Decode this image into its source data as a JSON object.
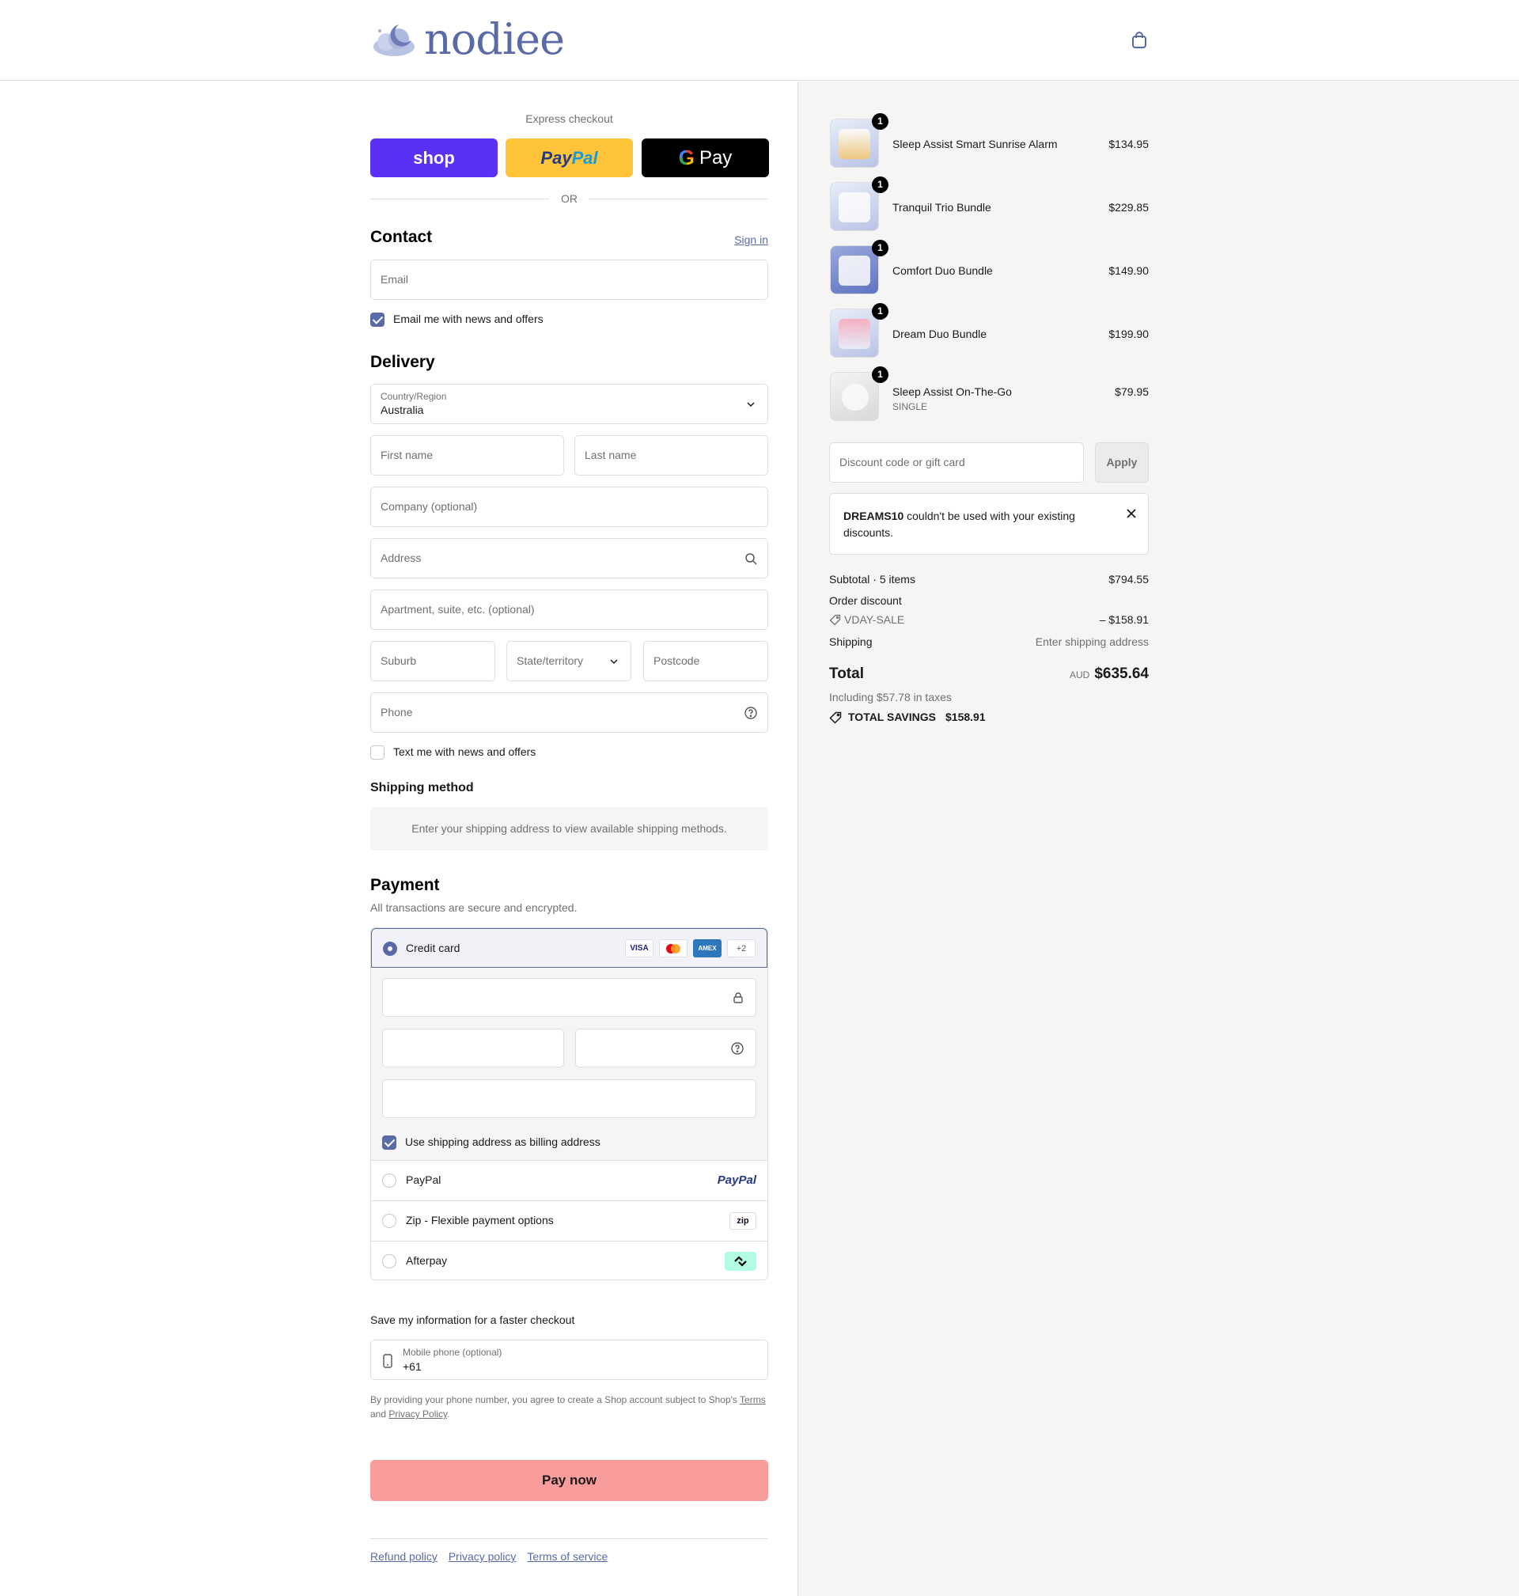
{
  "brand": {
    "name": "nodiee"
  },
  "express": {
    "title": "Express checkout",
    "shop_label": "shop",
    "paypal_a": "Pay",
    "paypal_b": "Pal",
    "gpay_g": "G",
    "gpay_label": "Pay",
    "or_label": "OR"
  },
  "contact": {
    "heading": "Contact",
    "sign_in": "Sign in",
    "email_placeholder": "Email",
    "news_label": "Email me with news and offers",
    "news_checked": true
  },
  "delivery": {
    "heading": "Delivery",
    "country_label": "Country/Region",
    "country_value": "Australia",
    "first_name": "First name",
    "last_name": "Last name",
    "company": "Company (optional)",
    "address": "Address",
    "apartment": "Apartment, suite, etc. (optional)",
    "suburb": "Suburb",
    "state": "State/territory",
    "postcode": "Postcode",
    "phone": "Phone",
    "text_label": "Text me with news and offers"
  },
  "shipping_method": {
    "heading": "Shipping method",
    "note": "Enter your shipping address to view available shipping methods."
  },
  "payment": {
    "heading": "Payment",
    "subtitle": "All transactions are secure and encrypted.",
    "credit_card": "Credit card",
    "card_logos": [
      "VISA",
      "AMEX",
      "+2"
    ],
    "billing_label": "Use shipping address as billing address",
    "options": [
      {
        "label": "PayPal",
        "logo": "PayPal"
      },
      {
        "label": "Zip - Flexible payment options",
        "logo": "zip"
      },
      {
        "label": "Afterpay",
        "logo": "afterpay-icon"
      }
    ]
  },
  "save_info": {
    "heading": "Save my information for a faster checkout",
    "mobile_label": "Mobile phone (optional)",
    "mobile_value": "+61",
    "legal_1": "By providing your phone number, you agree to create a Shop account subject to Shop's",
    "terms": "Terms",
    "and": "and",
    "privacy": "Privacy Policy",
    "period": "."
  },
  "pay_now": "Pay now",
  "footer": {
    "refund": "Refund policy",
    "privacy": "Privacy policy",
    "terms": "Terms of service"
  },
  "order": {
    "items": [
      {
        "name": "Sleep Assist Smart Sunrise Alarm",
        "price": "$134.95",
        "qty": "1",
        "variant": ""
      },
      {
        "name": "Tranquil Trio Bundle",
        "price": "$229.85",
        "qty": "1",
        "variant": ""
      },
      {
        "name": "Comfort Duo Bundle",
        "price": "$149.90",
        "qty": "1",
        "variant": ""
      },
      {
        "name": "Dream Duo Bundle",
        "price": "$199.90",
        "qty": "1",
        "variant": ""
      },
      {
        "name": "Sleep Assist On-The-Go",
        "price": "$79.95",
        "qty": "1",
        "variant": "SINGLE"
      }
    ],
    "discount_placeholder": "Discount code or gift card",
    "apply_label": "Apply",
    "alert_code": "DREAMS10",
    "alert_text_1": " couldn't be used with your existing",
    "alert_text_2": "discounts.",
    "subtotal_label": "Subtotal · 5 items",
    "subtotal_value": "$794.55",
    "order_discount_label": "Order discount",
    "discount_code": "VDAY-SALE",
    "discount_value": "– $158.91",
    "shipping_label": "Shipping",
    "shipping_value": "Enter shipping address",
    "total_label": "Total",
    "currency": "AUD",
    "total_value": "$635.64",
    "taxes": "Including $57.78 in taxes",
    "savings_label": "TOTAL SAVINGS",
    "savings_value": "$158.91"
  },
  "colors": {
    "accent": "#5a6aa8",
    "pay_button": "#f89c9c",
    "shop": "#5a31f4",
    "paypal": "#ffc439"
  }
}
